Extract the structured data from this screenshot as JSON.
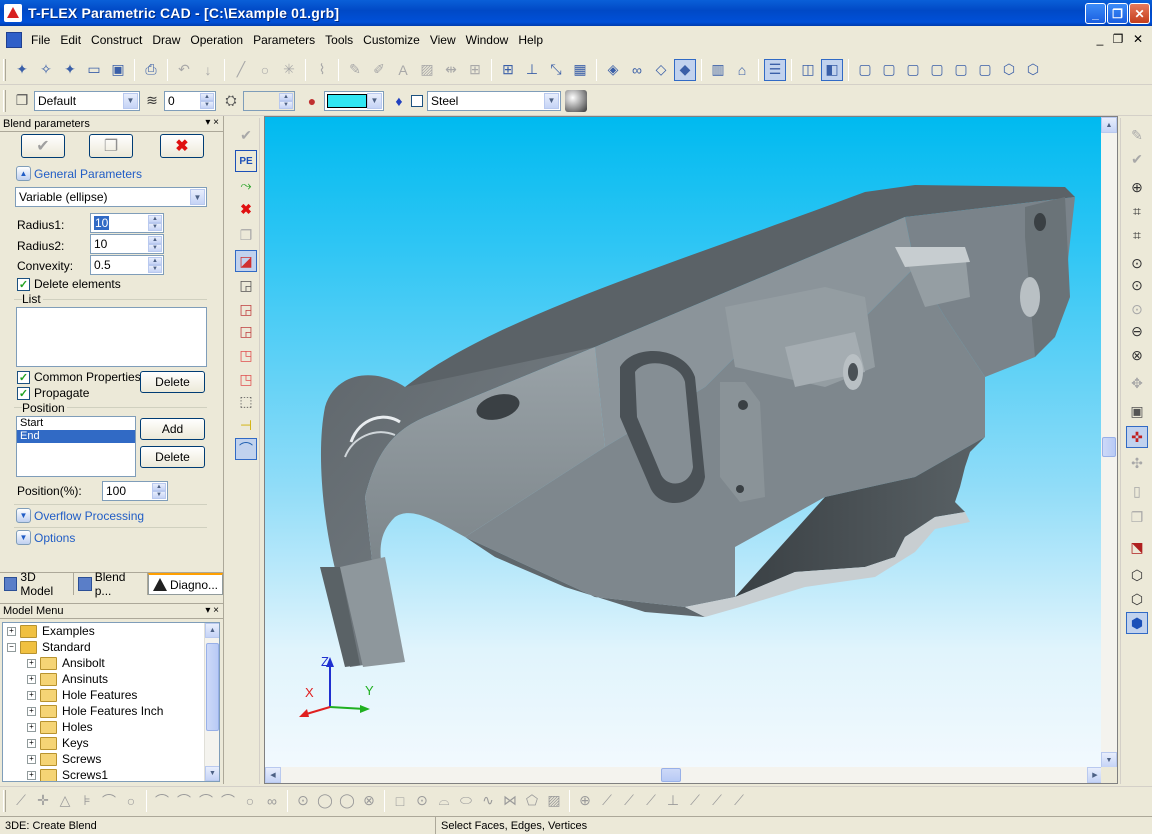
{
  "window": {
    "title": "T-FLEX Parametric CAD - [C:\\Example 01.grb]",
    "controls": [
      "_",
      "❐",
      "✕"
    ]
  },
  "menu": {
    "items": [
      "File",
      "Edit",
      "Construct",
      "Draw",
      "Operation",
      "Parameters",
      "Tools",
      "Customize",
      "View",
      "Window",
      "Help"
    ],
    "mdi_controls": [
      "_",
      "❐",
      "✕"
    ]
  },
  "props_toolbar": {
    "layer": "Default",
    "level": "0",
    "color": "#30e6f2",
    "material": "Steel"
  },
  "blend_panel": {
    "title": "Blend parameters",
    "header_controls": "▾ ×",
    "general_parameters": "General Parameters",
    "blend_type": "Variable (ellipse)",
    "radius1_label": "Radius1:",
    "radius1_value": "10",
    "radius2_label": "Radius2:",
    "radius2_value": "10",
    "convexity_label": "Convexity:",
    "convexity_value": "0.5",
    "delete_elements": "Delete elements",
    "list_label": "List",
    "common_properties": "Common Properties",
    "propagate": "Propagate",
    "delete_label": "Delete",
    "position_label": "Position",
    "position_items": [
      "Start",
      "End"
    ],
    "add_label": "Add",
    "position_percent_label": "Position(%):",
    "position_percent_value": "100",
    "overflow_processing": "Overflow Processing",
    "options": "Options"
  },
  "tabs": [
    "3D Model",
    "Blend p...",
    "Diagno..."
  ],
  "model_menu": {
    "title": "Model Menu",
    "header_controls": "▾ ×",
    "items": [
      {
        "label": "Examples",
        "level": 0,
        "expander": "+"
      },
      {
        "label": "Standard",
        "level": 0,
        "expander": "−"
      },
      {
        "label": "Ansibolt",
        "level": 1,
        "expander": "+"
      },
      {
        "label": "Ansinuts",
        "level": 1,
        "expander": "+"
      },
      {
        "label": "Hole Features",
        "level": 1,
        "expander": "+"
      },
      {
        "label": "Hole Features Inch",
        "level": 1,
        "expander": "+"
      },
      {
        "label": "Holes",
        "level": 1,
        "expander": "+"
      },
      {
        "label": "Keys",
        "level": 1,
        "expander": "+"
      },
      {
        "label": "Screws",
        "level": 1,
        "expander": "+"
      },
      {
        "label": "Screws1",
        "level": 1,
        "expander": "+"
      }
    ]
  },
  "viewport": {
    "axis_x": "X",
    "axis_y": "Y",
    "axis_z": "Z",
    "axis_colors": {
      "x": "#e02020",
      "y": "#20b020",
      "z": "#2030d0"
    },
    "model_color": "#7d868c"
  },
  "status": {
    "command": "3DE: Create Blend",
    "prompt": "Select Faces, Edges, Vertices"
  },
  "icons": {
    "ok": "checkmark-icon",
    "preview": "preview-icon",
    "cancel": "cancel-x-icon"
  }
}
